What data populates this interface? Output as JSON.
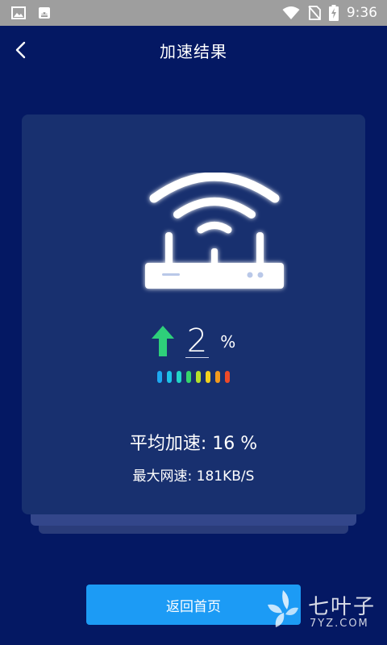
{
  "status_bar": {
    "time": "9:36",
    "icons": [
      "image-icon",
      "android-icon",
      "wifi-icon",
      "no-sim-icon",
      "battery-charging-icon"
    ]
  },
  "header": {
    "title": "加速结果",
    "back_icon": "chevron-left-icon"
  },
  "result": {
    "speed_increase": "2",
    "speed_unit": "%",
    "arrow_color": "#2ecf7a",
    "signal_colors": [
      "#1da8f0",
      "#1cc3e8",
      "#22d6c8",
      "#36d66a",
      "#b6e02a",
      "#f2d21e",
      "#f29a1e",
      "#ef4a28"
    ],
    "average_speedup": "平均加速: 16 %",
    "max_speed": "最大网速: 181KB/S"
  },
  "footer": {
    "home_button_label": "返回首页"
  },
  "watermark": {
    "text": "七叶子",
    "url": "7YZ.COM"
  },
  "colors": {
    "background": "#041863",
    "card": "#18306f",
    "button": "#1c9bf5"
  }
}
